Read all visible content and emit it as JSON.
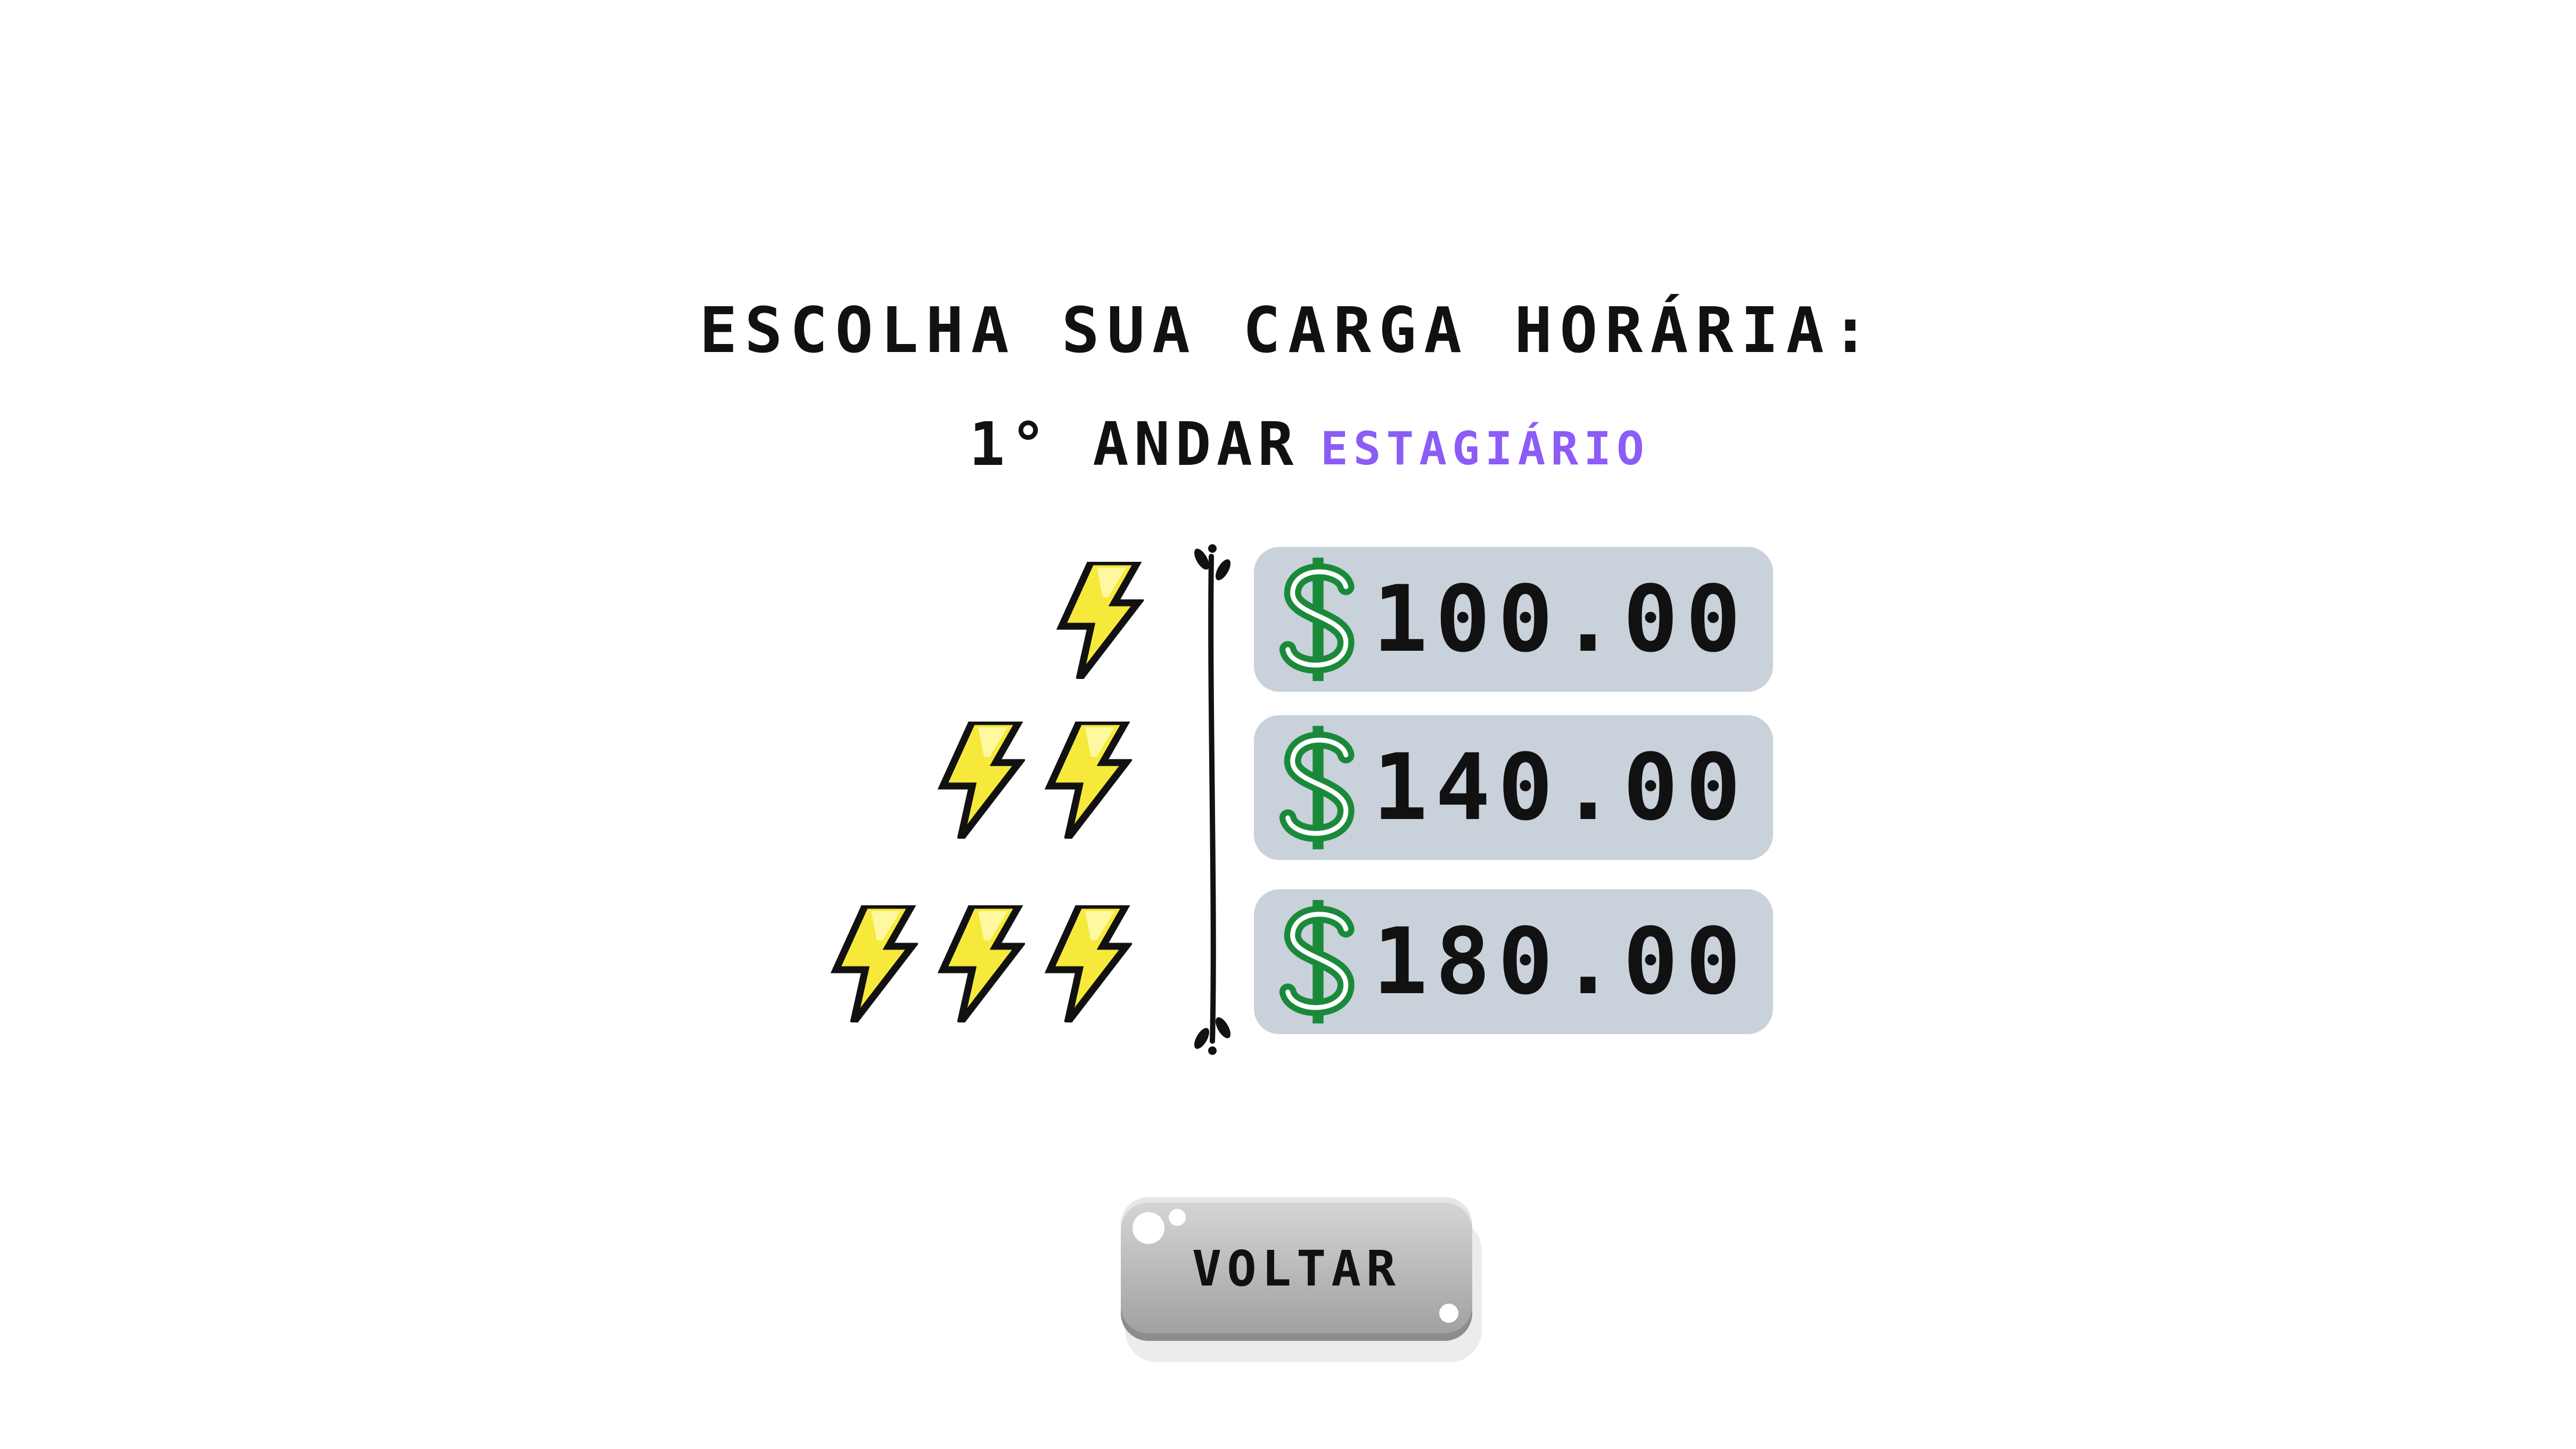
{
  "screen": {
    "title": "Escolha sua carga horária:",
    "floor_label": "1° andar",
    "role_label": "Estagiário"
  },
  "options": [
    {
      "energy_level": 1,
      "price": "100.00",
      "currency_icon": "dollar-sign-icon"
    },
    {
      "energy_level": 2,
      "price": "140.00",
      "currency_icon": "dollar-sign-icon"
    },
    {
      "energy_level": 3,
      "price": "180.00",
      "currency_icon": "dollar-sign-icon"
    }
  ],
  "back_button": {
    "label": "Voltar"
  },
  "colors": {
    "role_accent": "#8b5cf6",
    "option_background": "#c9d1da",
    "bolt_fill": "#f7e93a",
    "dollar_green": "#1a8a3a",
    "button_gray": "#b8b8b8"
  },
  "icons": {
    "energy": "lightning-bolt-icon",
    "divider": "bracket-divider-icon",
    "currency": "dollar-sign-icon"
  }
}
